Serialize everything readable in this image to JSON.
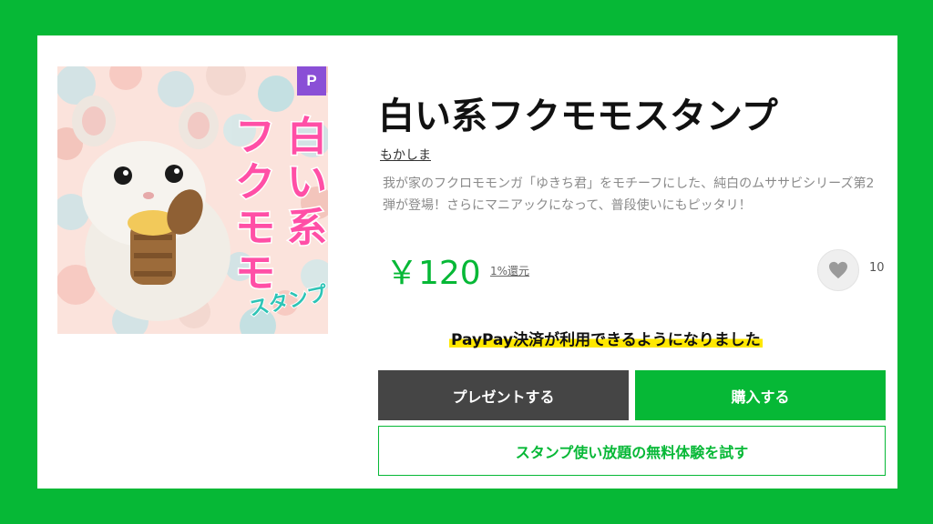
{
  "product": {
    "title": "白い系フクモモスタンプ",
    "author": "もかしま",
    "description": "我が家のフクロモモンガ「ゆきち君」をモチーフにした、純白のムササビシリーズ第2弾が登場！さらにマニアックになって、普段使いにもピッタリ！",
    "price": "￥120",
    "points_label": "1%還元",
    "favorite_count": "10",
    "badge": "P"
  },
  "thumbnail": {
    "title_lines": [
      "白い系",
      "フクモモ"
    ],
    "subtitle": "スタンプ",
    "title_color": "#ff4fa6"
  },
  "notice": {
    "paypay": "PayPay決済が利用できるようになりました"
  },
  "actions": {
    "present_label": "プレゼントする",
    "buy_label": "購入する",
    "trial_label": "スタンプ使い放題の無料体験を試す"
  },
  "colors": {
    "line_green": "#06b836",
    "dark_button": "#454545",
    "premium_badge": "#8a4fd6",
    "highlight": "#ffe800"
  }
}
